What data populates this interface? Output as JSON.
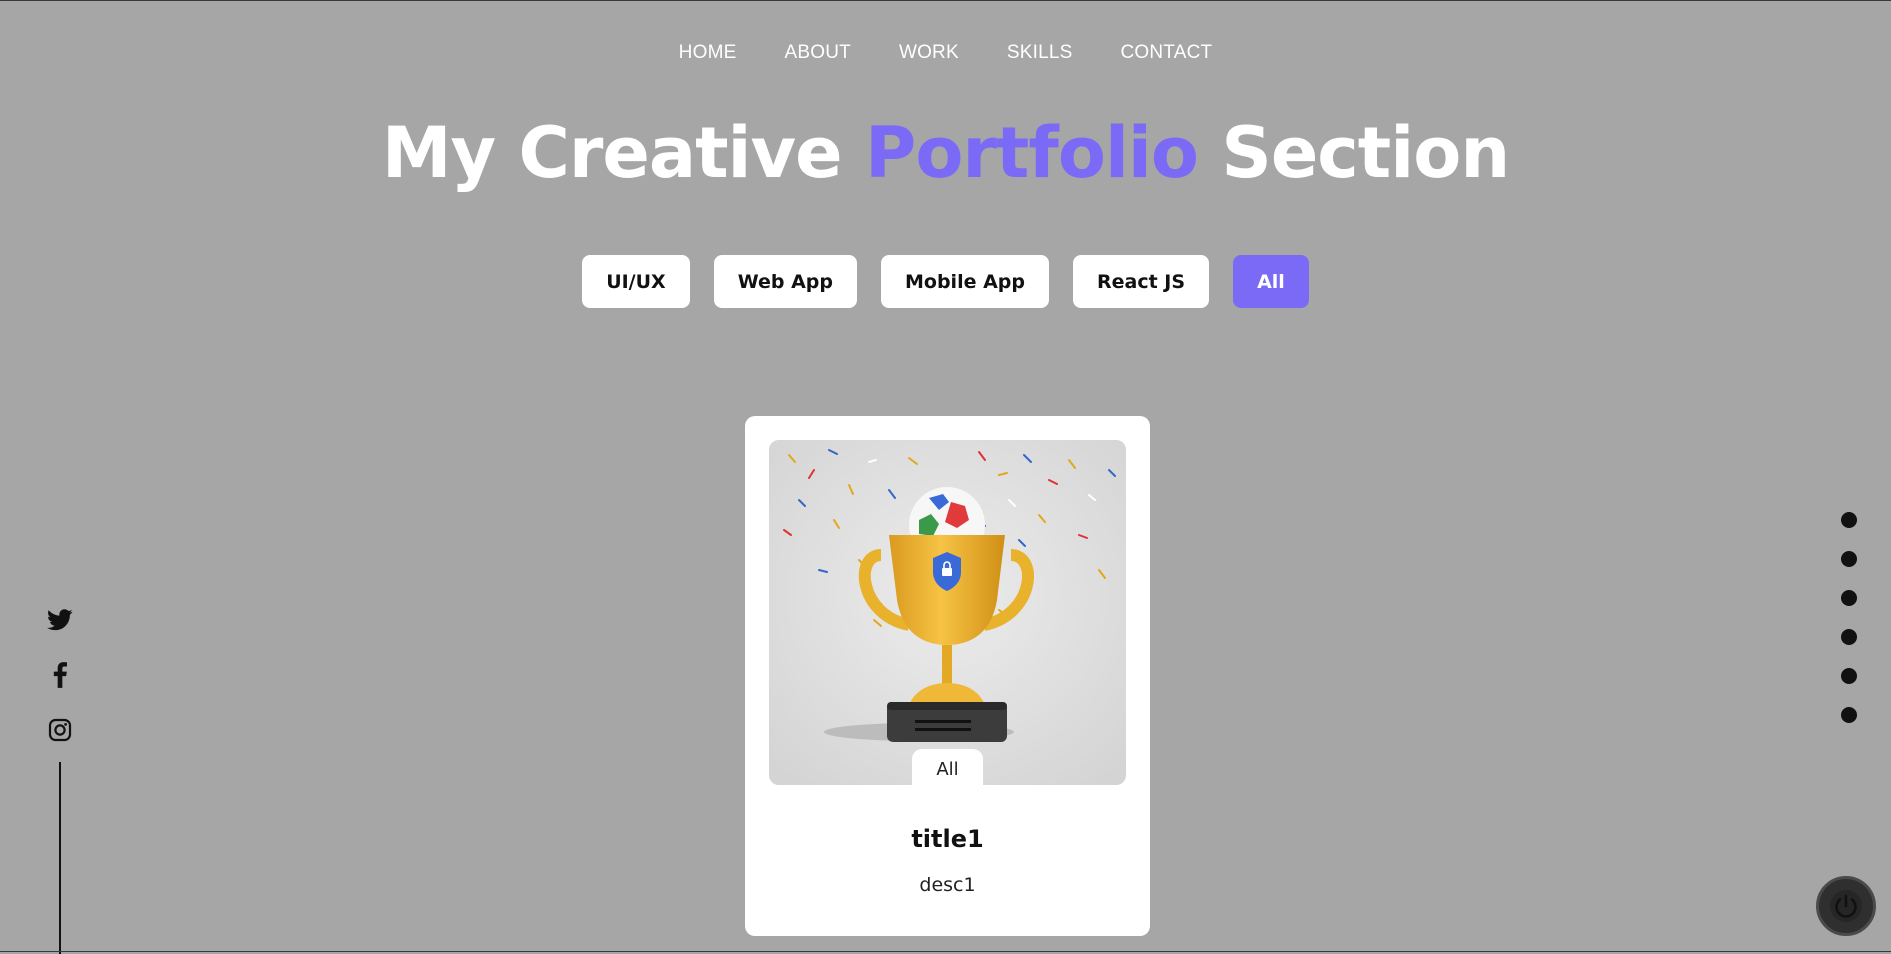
{
  "nav": {
    "items": [
      {
        "label": "HOME"
      },
      {
        "label": "ABOUT"
      },
      {
        "label": "WORK"
      },
      {
        "label": "SKILLS"
      },
      {
        "label": "CONTACT"
      }
    ]
  },
  "heading": {
    "part1": "My Creative ",
    "accent": "Portfolio",
    "part2": " Section"
  },
  "filters": [
    {
      "label": "UI/UX",
      "active": false
    },
    {
      "label": "Web App",
      "active": false
    },
    {
      "label": "Mobile App",
      "active": false
    },
    {
      "label": "React JS",
      "active": false
    },
    {
      "label": "All",
      "active": true
    }
  ],
  "card": {
    "tag": "All",
    "title": "title1",
    "desc": "desc1",
    "image_icon": "trophy-image"
  },
  "social": {
    "icons": [
      "twitter-icon",
      "facebook-icon",
      "instagram-icon"
    ]
  },
  "side_nav": {
    "dots": 6
  },
  "colors": {
    "background": "#a6a6a6",
    "accent": "#7b6af6",
    "card": "#ffffff"
  }
}
